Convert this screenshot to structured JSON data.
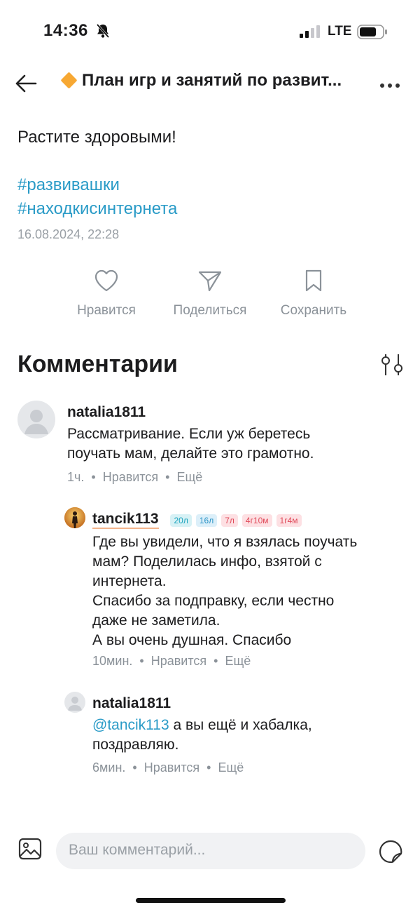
{
  "status_bar": {
    "time": "14:36",
    "network": "LTE"
  },
  "header": {
    "title": "План игр и занятий по развит..."
  },
  "post": {
    "text": "Растите здоровыми!",
    "tags": [
      "#развивашки",
      "#находкисинтернета"
    ],
    "date": "16.08.2024, 22:28"
  },
  "actions": {
    "like": "Нравится",
    "share": "Поделиться",
    "save": "Сохранить"
  },
  "comments": {
    "heading": "Комментарии",
    "items": [
      {
        "user": "natalia1811",
        "text_lines": [
          "Рассматривание. Если уж беретесь",
          "поучать мам, делайте это грамотно."
        ],
        "time": "1ч.",
        "like": "Нравится",
        "more": "Ещё"
      },
      {
        "user": "tancik113",
        "badges": [
          "20л",
          "16л",
          "7л",
          "4г10м",
          "1г4м"
        ],
        "text_lines": [
          "Где вы увидели, что я взялась поучать",
          "мам? Поделилась инфо, взятой с",
          "интернета.",
          "Спасибо за подправку, если честно",
          "даже не заметила.",
          "А вы очень душная. Спасибо"
        ],
        "time": "10мин.",
        "like": "Нравится",
        "more": "Ещё"
      },
      {
        "user": "natalia1811",
        "mention": "@tancik113",
        "text_after_mention": " а вы ещё и хабалка,",
        "text_line2": "поздравляю.",
        "time": "6мин.",
        "like": "Нравится",
        "more": "Ещё"
      }
    ]
  },
  "composer": {
    "placeholder": "Ваш комментарий..."
  },
  "colors": {
    "accent": "#2a9bc7",
    "diamond": "#f7a833"
  }
}
